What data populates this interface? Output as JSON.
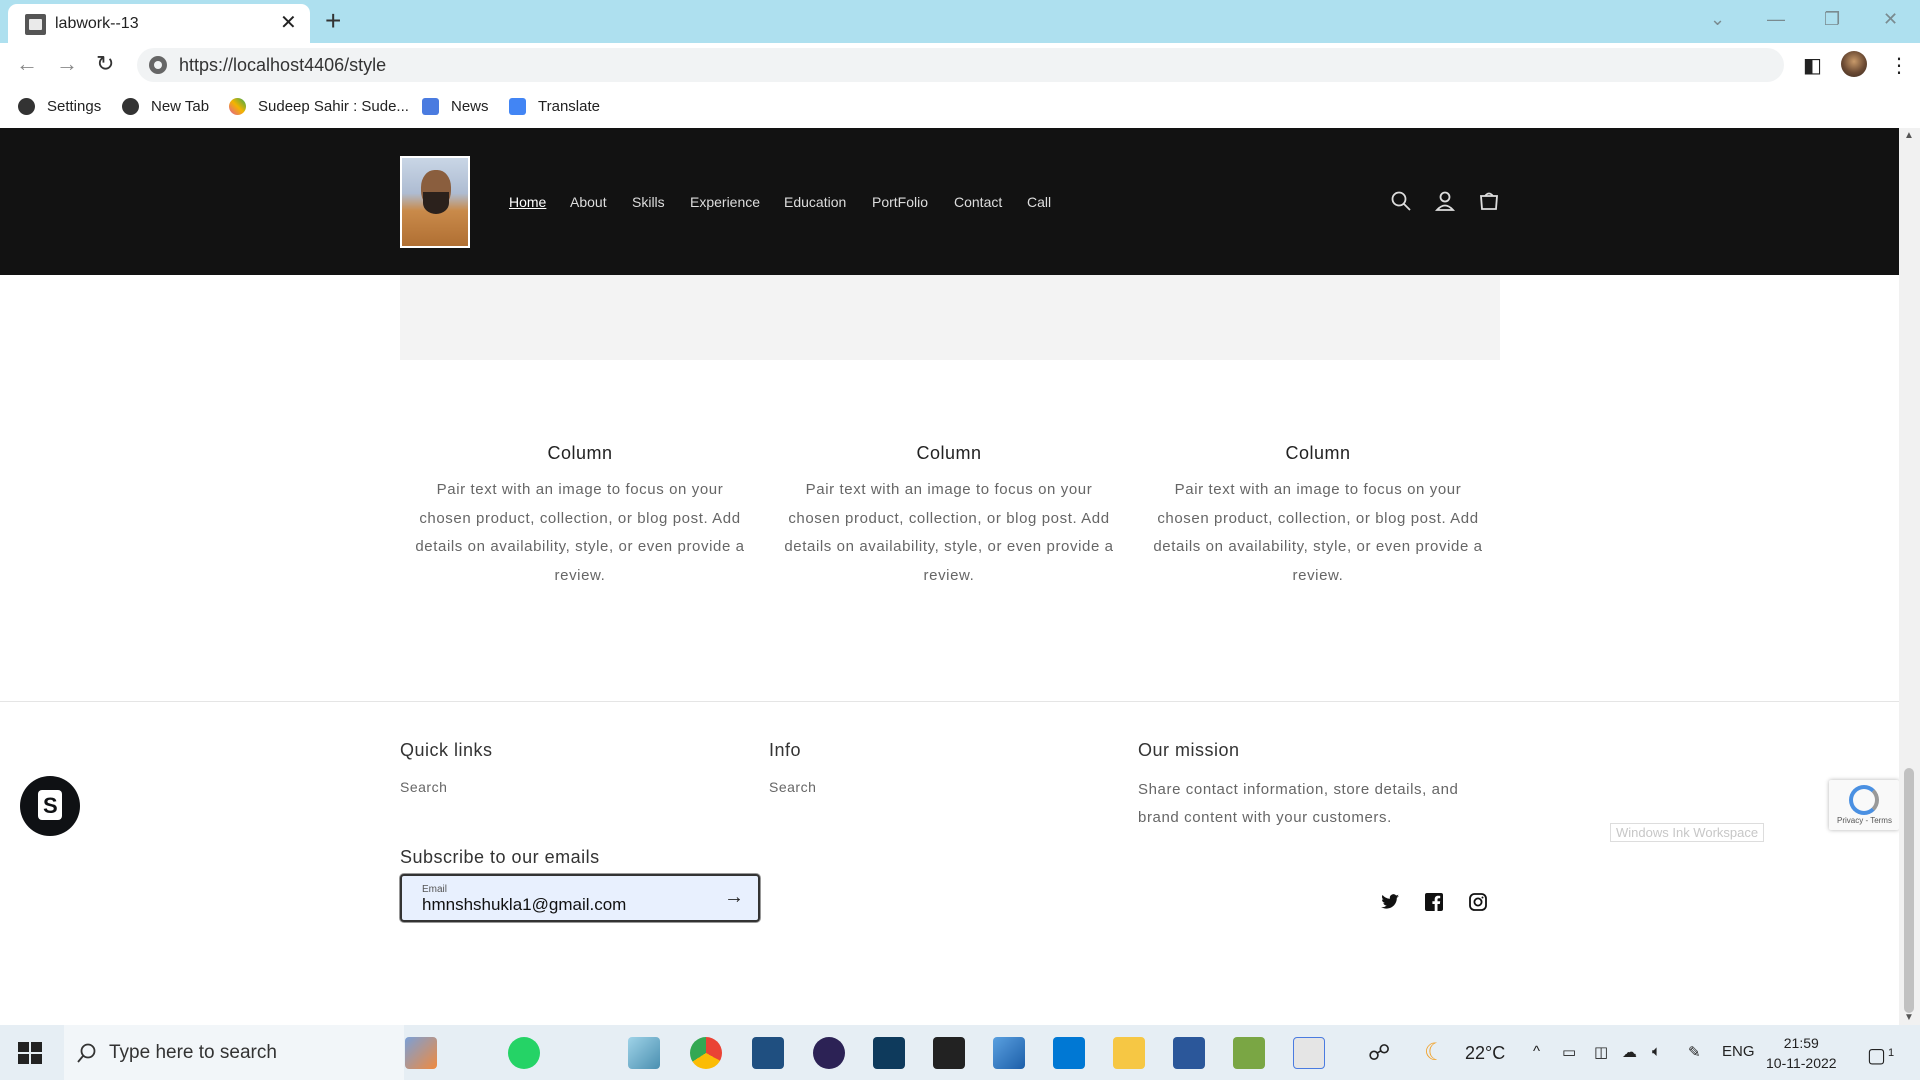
{
  "browser": {
    "tab_title": "labwork--13",
    "url": "https://localhost4406/style",
    "bookmarks": [
      {
        "label": "Settings",
        "icon": "gear-icon",
        "color": "#333333"
      },
      {
        "label": "New Tab",
        "icon": "globe-icon",
        "color": "#333333"
      },
      {
        "label": "Sudeep Sahir : Sude...",
        "icon": "colorful-logo-icon",
        "color": "#e25a9b"
      },
      {
        "label": "News",
        "icon": "news-icon",
        "color": "#4a7be0"
      },
      {
        "label": "Translate",
        "icon": "translate-icon",
        "color": "#4285f4"
      }
    ]
  },
  "site": {
    "nav": [
      "Home",
      "About",
      "Skills",
      "Experience",
      "Education",
      "PortFolio",
      "Contact",
      "Call"
    ],
    "active_nav": "Home",
    "columns": [
      {
        "title": "Column",
        "text": "Pair text with an image to focus on your chosen product, collection, or blog post. Add details on availability, style, or even provide a review."
      },
      {
        "title": "Column",
        "text": "Pair text with an image to focus on your chosen product, collection, or blog post. Add details on availability, style, or even provide a review."
      },
      {
        "title": "Column",
        "text": "Pair text with an image to focus on your chosen product, collection, or blog post. Add details on availability, style, or even provide a review."
      }
    ],
    "footer": {
      "quick_links_title": "Quick links",
      "quick_links": [
        "Search"
      ],
      "info_title": "Info",
      "info_links": [
        "Search"
      ],
      "mission_title": "Our mission",
      "mission_text": "Share contact information, store details, and brand content with your customers.",
      "subscribe_title": "Subscribe to our emails",
      "email_label": "Email",
      "email_value": "hmnshshukla1@gmail.com"
    },
    "social": [
      "twitter-icon",
      "facebook-icon",
      "instagram-icon"
    ]
  },
  "overlays": {
    "recaptcha_text": "Privacy - Terms",
    "ink_workspace": "Windows Ink Workspace"
  },
  "taskbar": {
    "search_placeholder": "Type here to search",
    "weather": "22°C",
    "language": "ENG",
    "time": "21:59",
    "date": "10-11-2022",
    "notification_count": "1"
  }
}
